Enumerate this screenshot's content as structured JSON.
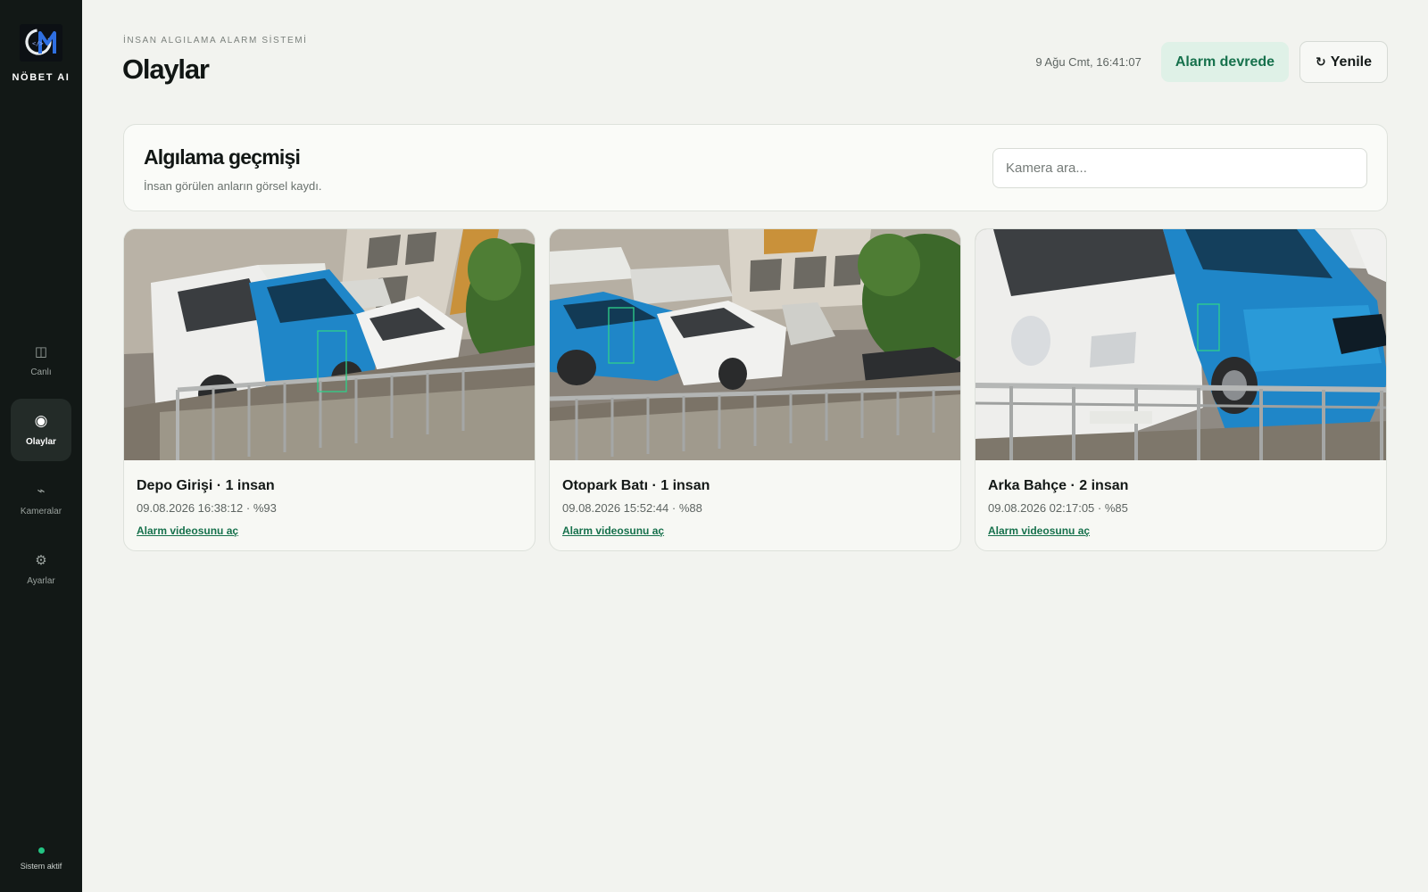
{
  "sidebar": {
    "brand": "NÖBET AI",
    "items": [
      {
        "label": "Canlı",
        "icon": "split-view-icon",
        "active": false
      },
      {
        "label": "Olaylar",
        "icon": "record-dot-icon",
        "active": true
      },
      {
        "label": "Kameralar",
        "icon": "camera-icon",
        "active": false
      },
      {
        "label": "Ayarlar",
        "icon": "gear-icon",
        "active": false
      }
    ],
    "status_label": "Sistem aktif",
    "status_color": "#23c483"
  },
  "header": {
    "eyebrow": "İNSAN ALGILAMA ALARM SİSTEMİ",
    "title": "Olaylar",
    "clock": "9 Ağu Cmt, 16:41:07",
    "alarm_badge": "Alarm devrede",
    "refresh_label": "Yenile",
    "refresh_icon": "↻"
  },
  "history": {
    "title": "Algılama geçmişi",
    "subtitle": "İnsan görülen anların görsel kaydı.",
    "search_placeholder": "Kamera ara..."
  },
  "events": [
    {
      "title": "Depo Girişi · 1 insan",
      "meta": "09.08.2026 16:38:12 · %93",
      "link": "Alarm videosunu aç"
    },
    {
      "title": "Otopark Batı · 1 insan",
      "meta": "09.08.2026 15:52:44 · %88",
      "link": "Alarm videosunu aç"
    },
    {
      "title": "Arka Bahçe · 2 insan",
      "meta": "09.08.2026 02:17:05 · %85",
      "link": "Alarm videosunu aç"
    }
  ],
  "colors": {
    "accent": "#16714c",
    "accent_bg": "#dff1e7",
    "sidebar_bg": "#121816",
    "detection_box": "#2fd18a"
  }
}
